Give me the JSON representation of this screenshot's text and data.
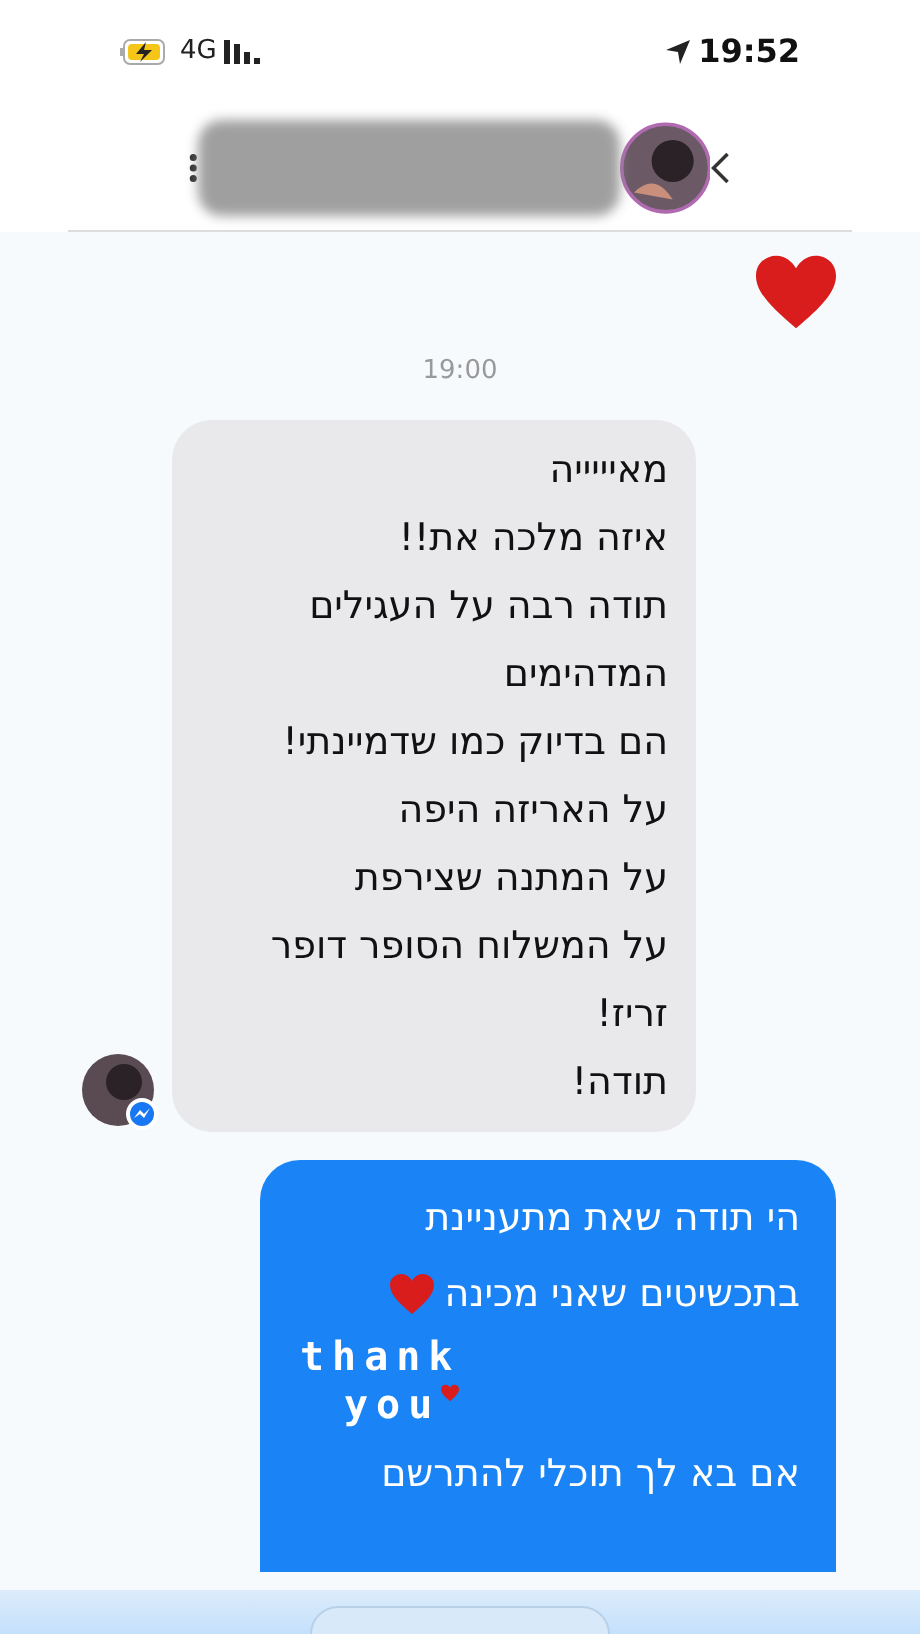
{
  "status_bar": {
    "network": "4G",
    "time": "19:52"
  },
  "messages": [
    {
      "kind": "emoji_heart",
      "outgoing": true
    },
    {
      "kind": "timestamp",
      "text": "19:00"
    },
    {
      "kind": "text",
      "outgoing": false,
      "lines": [
        "מאיייייה",
        "איזה מלכה את!!",
        "תודה רבה על העגילים",
        "המדהימים",
        "הם בדיוק כמו שדמיינתי!",
        "על האריזה היפה",
        "על המתנה שצירפת",
        "על המשלוח הסופר דופר",
        "זריז!",
        "תודה!"
      ]
    },
    {
      "kind": "rich",
      "outgoing": true,
      "lines": [
        {
          "text": "הי תודה שאת מתעניינת",
          "heart": false
        },
        {
          "text": "בתכשיטים שאני מכינה",
          "heart": true
        }
      ],
      "sticker_lines": [
        "thank",
        "you"
      ],
      "after_lines": [
        "אם בא לך תוכלי להתרשם"
      ]
    }
  ]
}
